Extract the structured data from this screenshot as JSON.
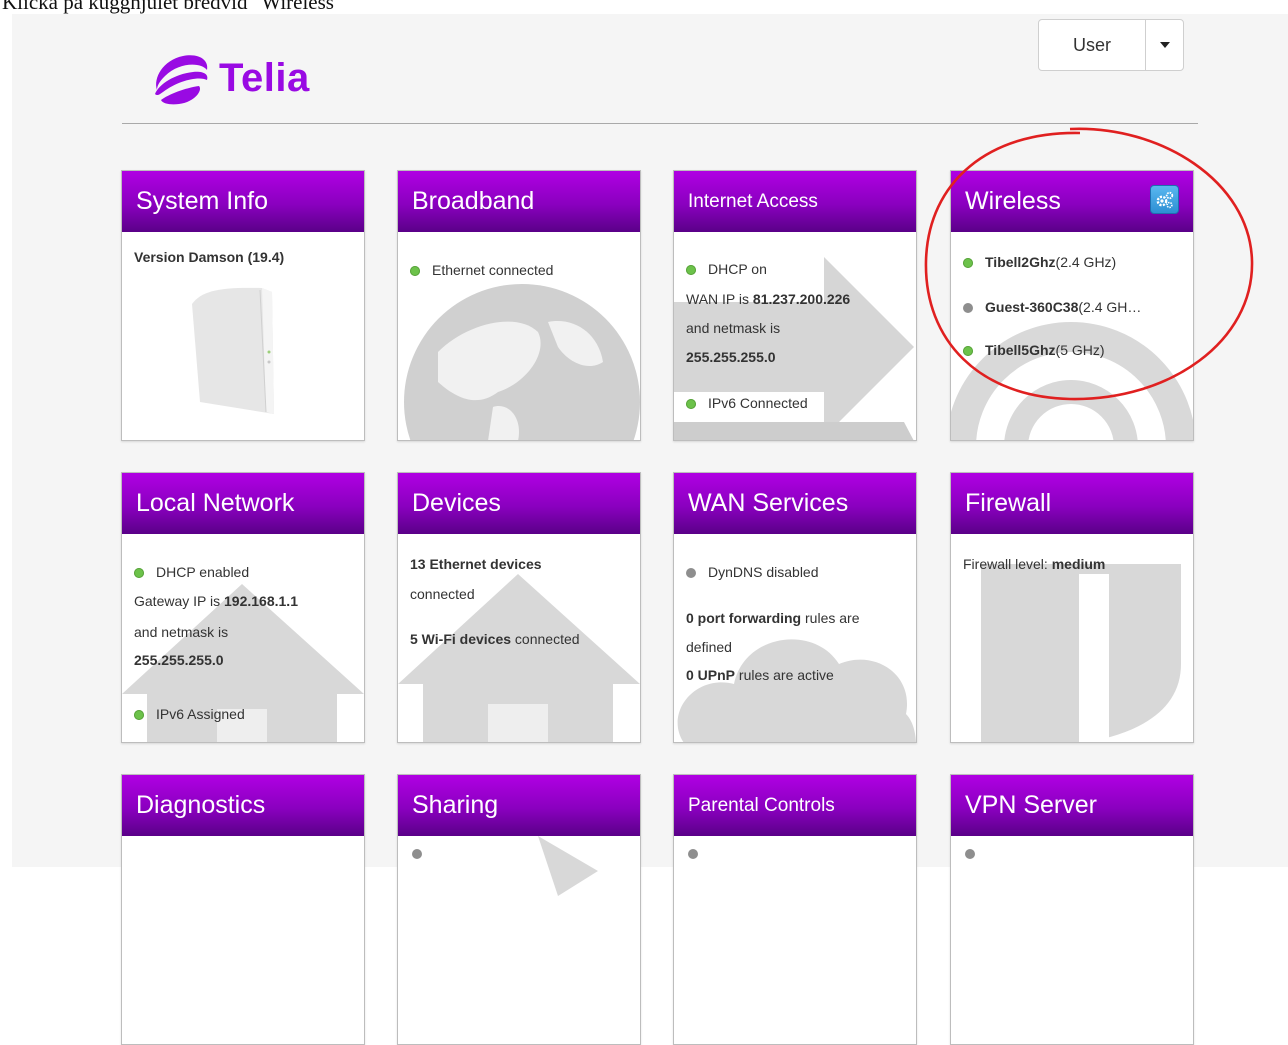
{
  "caption": "Klicka på kugghjulet bredvid \"Wireless\"",
  "header": {
    "logo_text": "Telia",
    "user_label": "User"
  },
  "colors": {
    "brand": "#990ae3",
    "header_top": "#b000e3",
    "header_bottom": "#5a0088",
    "status_green": "#6cc24a",
    "status_gray": "#8e8e8e",
    "annotation_red": "#e02020"
  },
  "cards": {
    "system_info": {
      "title": "System Info",
      "version": "Version Damson (19.4)"
    },
    "broadband": {
      "title": "Broadband",
      "status": "Ethernet connected"
    },
    "internet_access": {
      "title": "Internet Access",
      "line1": "DHCP on",
      "wan_ip_label": "WAN IP is ",
      "wan_ip": "81.237.200.226",
      "netmask_label": "and netmask is",
      "netmask": "255.255.255.0",
      "ipv6": "IPv6 Connected"
    },
    "wireless": {
      "title": "Wireless",
      "settings_icon": "gears-icon",
      "networks": [
        {
          "name": "Tibell2Ghz",
          "band": "(2.4 GHz)",
          "status": "green"
        },
        {
          "name": "Guest-360C38",
          "band": "(2.4 GH…",
          "status": "gray"
        },
        {
          "name": "Tibell5Ghz",
          "band": "(5 GHz)",
          "status": "green"
        }
      ]
    },
    "local_network": {
      "title": "Local Network",
      "dhcp": "DHCP enabled",
      "gateway_label": "Gateway IP is ",
      "gateway_ip": "192.168.1.1",
      "netmask_label": "and netmask is",
      "netmask": "255.255.255.0",
      "ipv6": "IPv6 Assigned"
    },
    "devices": {
      "title": "Devices",
      "ethernet_line1": "13 Ethernet devices",
      "ethernet_line2": "connected",
      "wifi_bold": "5 Wi-Fi devices",
      "wifi_rest": " connected"
    },
    "wan_services": {
      "title": "WAN Services",
      "dyndns": "DynDNS disabled",
      "pf_bold": "0 port forwarding",
      "pf_rest": " rules are",
      "pf_line2": "defined",
      "upnp_bold": "0 UPnP",
      "upnp_rest": " rules are active"
    },
    "firewall": {
      "title": "Firewall",
      "level_label": "Firewall level: ",
      "level": "medium"
    },
    "diagnostics": {
      "title": "Diagnostics"
    },
    "sharing": {
      "title": "Sharing"
    },
    "parental_controls": {
      "title": "Parental Controls"
    },
    "vpn_server": {
      "title": "VPN Server"
    }
  }
}
